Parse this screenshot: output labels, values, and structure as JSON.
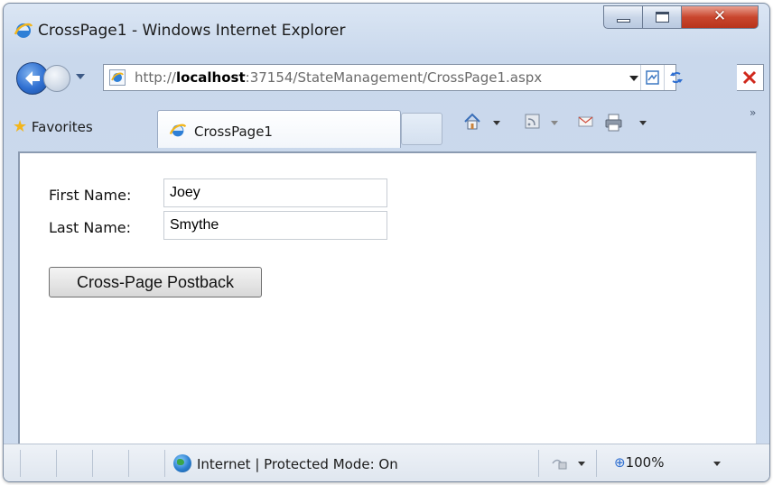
{
  "window": {
    "title": "CrossPage1 - Windows Internet Explorer"
  },
  "nav": {
    "address_prefix": "http://",
    "address_host": "localhost",
    "address_rest": ":37154/StateManagement/CrossPage1.aspx"
  },
  "tabs": {
    "favorites_label": "Favorites",
    "active_tab_label": "CrossPage1",
    "overflow_label": "»"
  },
  "form": {
    "first_name_label": "First Name:",
    "first_name_value": "Joey",
    "last_name_label": "Last Name:",
    "last_name_value": "Smythe",
    "submit_label": "Cross-Page Postback"
  },
  "status": {
    "zone_text": "Internet | Protected Mode: On",
    "zoom_text": "100%"
  }
}
